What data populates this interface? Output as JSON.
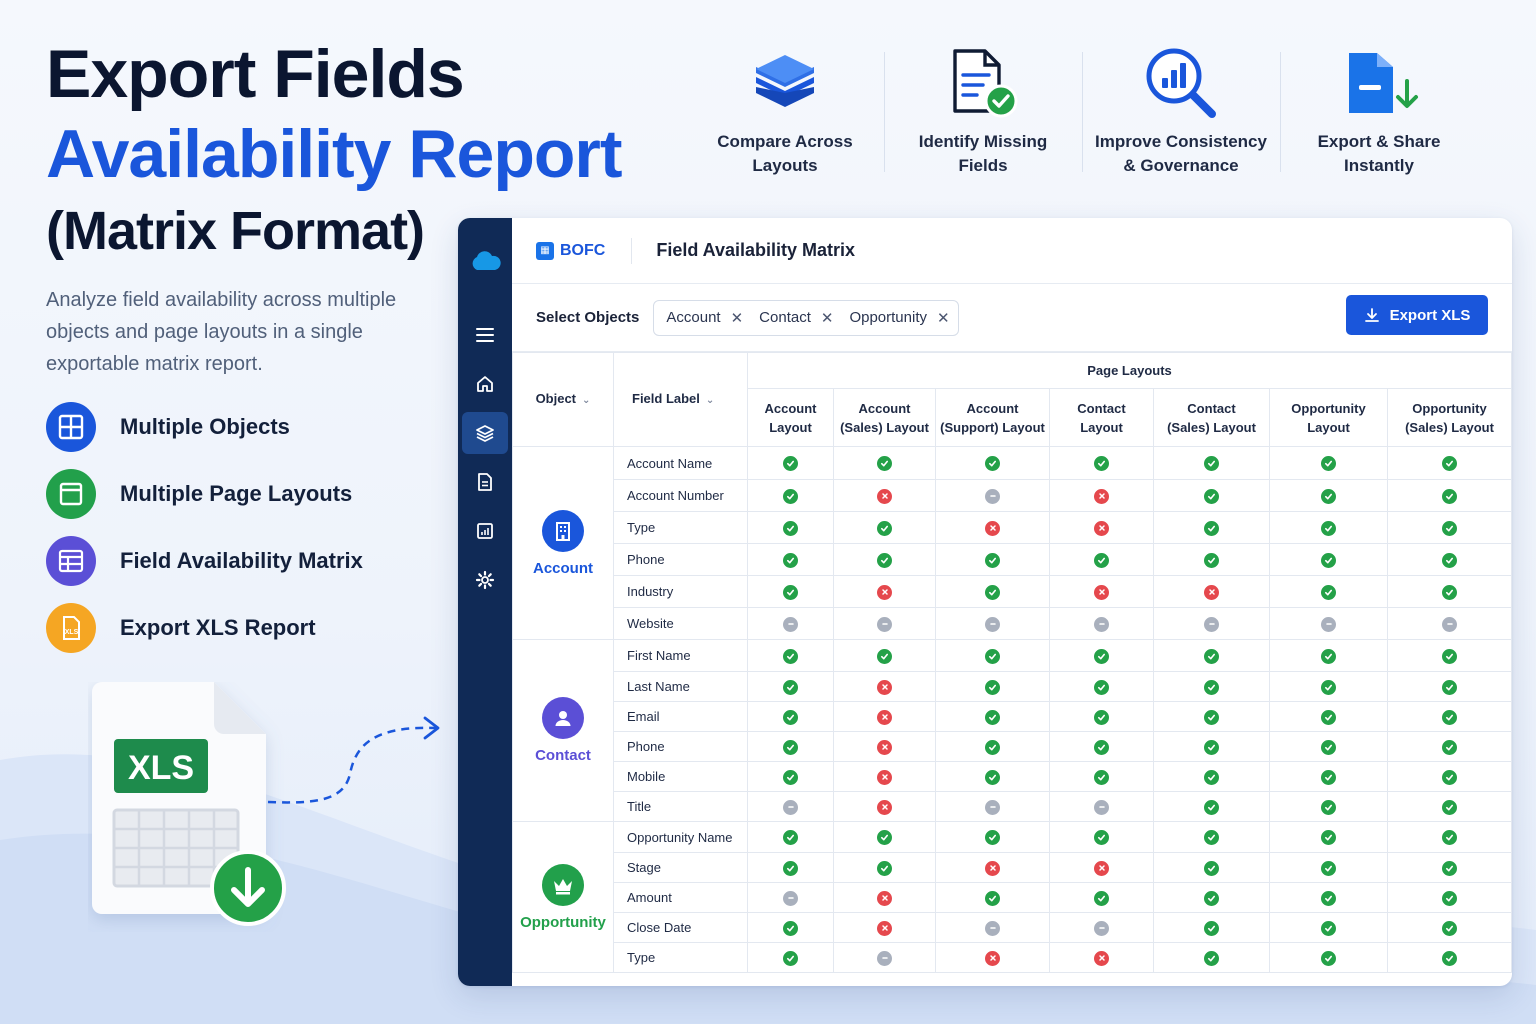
{
  "hero": {
    "title_line1": "Export Fields",
    "title_line2": "Availability Report",
    "title_line3": "(Matrix Format)",
    "description": "Analyze field availability across multiple objects and page layouts in a single exportable matrix report."
  },
  "features": [
    {
      "label": "Multiple Objects",
      "icon": "grid-icon",
      "color": "#1a56db"
    },
    {
      "label": "Multiple Page Layouts",
      "icon": "layout-icon",
      "color": "#22a04b"
    },
    {
      "label": "Field Availability Matrix",
      "icon": "table-icon",
      "color": "#5b4fd6"
    },
    {
      "label": "Export XLS Report",
      "icon": "xls-file-icon",
      "color": "#f5a623"
    }
  ],
  "benefits": [
    {
      "label": "Compare Across\nLayouts",
      "icon": "layers-icon"
    },
    {
      "label": "Identify Missing\nFields",
      "icon": "document-check-icon"
    },
    {
      "label": "Improve Consistency\n& Governance",
      "icon": "magnifier-chart-icon"
    },
    {
      "label": "Export & Share\nInstantly",
      "icon": "file-download-icon"
    }
  ],
  "illustration": {
    "xls_badge": "XLS"
  },
  "app": {
    "brand": "BOFC",
    "title": "Field Availability Matrix",
    "select_label": "Select Objects",
    "chips": [
      "Account",
      "Contact",
      "Opportunity"
    ],
    "export_label": "Export XLS",
    "sidebar_icons": [
      "cloud-logo-icon",
      "menu-icon",
      "home-icon",
      "layers-icon",
      "document-icon",
      "report-icon",
      "gear-icon"
    ],
    "colors": {
      "accent": "#1a56db",
      "sidebar": "#102a56",
      "yes": "#24a148",
      "no": "#e5484d",
      "na": "#a9b0bd"
    }
  },
  "matrix": {
    "object_header": "Object",
    "field_header": "Field Label",
    "group_header": "Page Layouts",
    "layouts": [
      "Account\nLayout",
      "Account\n(Sales) Layout",
      "Account\n(Support) Layout",
      "Contact\nLayout",
      "Contact\n(Sales) Layout",
      "Opportunity\nLayout",
      "Opportunity\n(Sales) Layout"
    ],
    "groups": [
      {
        "object": "Account",
        "color": "#1a56db",
        "icon": "building-icon",
        "rows": [
          {
            "field": "Account Name",
            "status": [
              "yes",
              "yes",
              "yes",
              "yes",
              "yes",
              "yes",
              "yes"
            ]
          },
          {
            "field": "Account Number",
            "status": [
              "yes",
              "no",
              "na",
              "no",
              "yes",
              "yes",
              "yes"
            ]
          },
          {
            "field": "Type",
            "status": [
              "yes",
              "yes",
              "no",
              "no",
              "yes",
              "yes",
              "yes"
            ]
          },
          {
            "field": "Phone",
            "status": [
              "yes",
              "yes",
              "yes",
              "yes",
              "yes",
              "yes",
              "yes"
            ]
          },
          {
            "field": "Industry",
            "status": [
              "yes",
              "no",
              "yes",
              "no",
              "no",
              "yes",
              "yes"
            ]
          },
          {
            "field": "Website",
            "status": [
              "na",
              "na",
              "na",
              "na",
              "na",
              "na",
              "na"
            ]
          }
        ]
      },
      {
        "object": "Contact",
        "color": "#5b4fd6",
        "icon": "person-icon",
        "rows": [
          {
            "field": "First Name",
            "status": [
              "yes",
              "yes",
              "yes",
              "yes",
              "yes",
              "yes",
              "yes"
            ]
          },
          {
            "field": "Last Name",
            "status": [
              "yes",
              "no",
              "yes",
              "yes",
              "yes",
              "yes",
              "yes"
            ]
          },
          {
            "field": "Email",
            "status": [
              "yes",
              "no",
              "yes",
              "yes",
              "yes",
              "yes",
              "yes"
            ]
          },
          {
            "field": "Phone",
            "status": [
              "yes",
              "no",
              "yes",
              "yes",
              "yes",
              "yes",
              "yes"
            ]
          },
          {
            "field": "Mobile",
            "status": [
              "yes",
              "no",
              "yes",
              "yes",
              "yes",
              "yes",
              "yes"
            ]
          },
          {
            "field": "Title",
            "status": [
              "na",
              "no",
              "na",
              "na",
              "yes",
              "yes",
              "yes"
            ]
          }
        ]
      },
      {
        "object": "Opportunity",
        "color": "#22a04b",
        "icon": "crown-icon",
        "rows": [
          {
            "field": "Opportunity Name",
            "status": [
              "yes",
              "yes",
              "yes",
              "yes",
              "yes",
              "yes",
              "yes"
            ]
          },
          {
            "field": "Stage",
            "status": [
              "yes",
              "yes",
              "no",
              "no",
              "yes",
              "yes",
              "yes"
            ]
          },
          {
            "field": "Amount",
            "status": [
              "na",
              "no",
              "yes",
              "yes",
              "yes",
              "yes",
              "yes"
            ]
          },
          {
            "field": "Close Date",
            "status": [
              "yes",
              "no",
              "na",
              "na",
              "yes",
              "yes",
              "yes"
            ]
          },
          {
            "field": "Type",
            "status": [
              "yes",
              "na",
              "no",
              "no",
              "yes",
              "yes",
              "yes"
            ]
          }
        ]
      }
    ]
  }
}
